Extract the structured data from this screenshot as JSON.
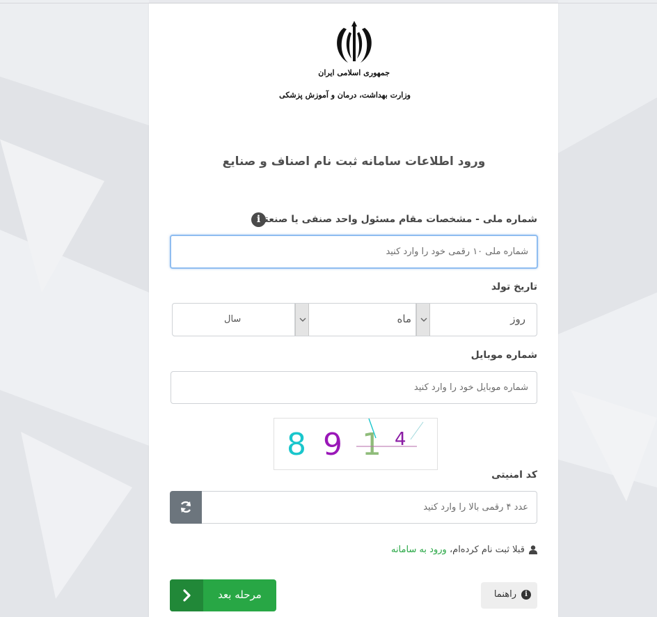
{
  "logo": {
    "line1": "جمهوری اسلامی ایران",
    "line2": "وزارت بهداشت، درمان و آموزش پزشکی"
  },
  "title": "ورود اطلاعات سامانه ثبت نام اصناف و صنایع",
  "national_id": {
    "label": "شماره ملی - مشخصات مقام مسئول واحد صنفی یا صنعتی",
    "placeholder": "شماره ملی ۱۰ رقمی خود را وارد کنید"
  },
  "birth_date": {
    "label": "تاریخ تولد",
    "day": "روز",
    "month": "ماه",
    "year": "سال"
  },
  "mobile": {
    "label": "شماره موبایل",
    "placeholder": "شماره موبایل خود را وارد کنید"
  },
  "captcha": {
    "digits": [
      "8",
      "9",
      "1",
      "4"
    ],
    "colors": [
      "#19c6cc",
      "#9a17b8",
      "#8fbc7a",
      "#8a1ba4"
    ]
  },
  "security_code": {
    "label": "کد امنیتی",
    "placeholder": "عدد ۴ رقمی بالا را وارد کنید"
  },
  "already_registered": {
    "text": "قبلا ثبت نام کرده‌ام،",
    "link": "ورود به سامانه"
  },
  "buttons": {
    "guide": "راهنما",
    "next": "مرحله بعد"
  },
  "colors": {
    "primary_green": "#28a745",
    "dark_green": "#218838",
    "refresh_gray": "#6c757d",
    "focus_blue": "#8fbdf0"
  },
  "icons": {
    "info": "info-circle-icon",
    "refresh": "refresh-icon",
    "user": "user-icon",
    "next": "chevron-left-icon"
  }
}
